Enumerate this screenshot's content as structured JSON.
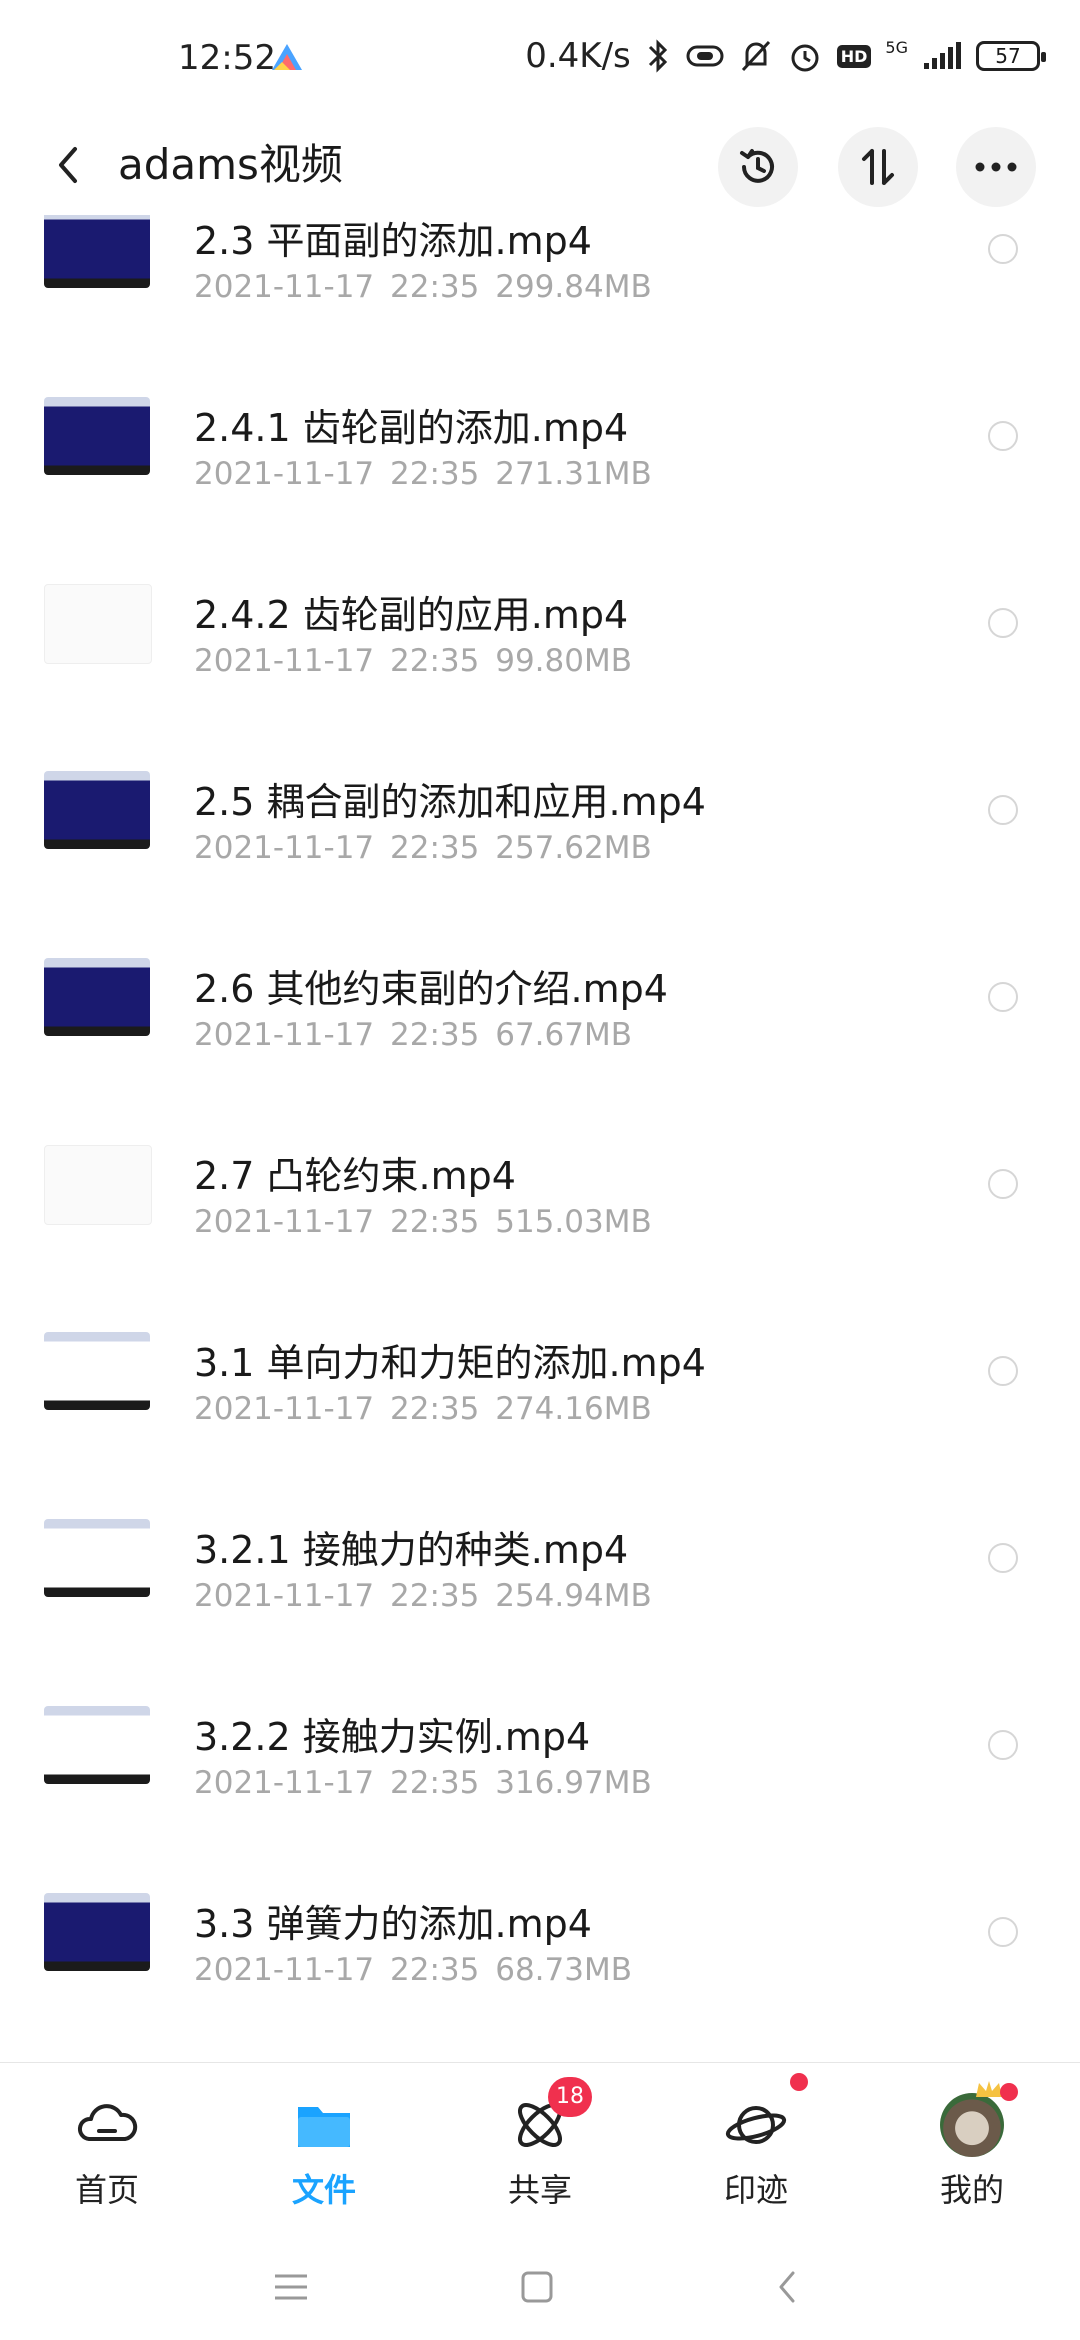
{
  "status_bar": {
    "time": "12:52",
    "network_speed": "0.4K/s",
    "network_type": "5G",
    "battery": "57",
    "hd": "HD",
    "icons": [
      "bluetooth-icon",
      "link-icon",
      "mute-bell-icon",
      "alarm-icon",
      "hd-icon",
      "signal-icon",
      "battery-icon"
    ]
  },
  "header": {
    "title": "adams视频",
    "back_icon": "chevron-left-icon",
    "actions": [
      "history-icon",
      "sort-icon",
      "more-icon"
    ]
  },
  "files": [
    {
      "name": "2.3 平面副的添加.mp4",
      "date": "2021-11-17",
      "time": "22:35",
      "size": "299.84MB",
      "thumb": "blue"
    },
    {
      "name": "2.4.1 齿轮副的添加.mp4",
      "date": "2021-11-17",
      "time": "22:35",
      "size": "271.31MB",
      "thumb": "blue"
    },
    {
      "name": "2.4.2 齿轮副的应用.mp4",
      "date": "2021-11-17",
      "time": "22:35",
      "size": "99.80MB",
      "thumb": "white"
    },
    {
      "name": "2.5 耦合副的添加和应用.mp4",
      "date": "2021-11-17",
      "time": "22:35",
      "size": "257.62MB",
      "thumb": "blue"
    },
    {
      "name": "2.6 其他约束副的介绍.mp4",
      "date": "2021-11-17",
      "time": "22:35",
      "size": "67.67MB",
      "thumb": "blue"
    },
    {
      "name": "2.7 凸轮约束.mp4",
      "date": "2021-11-17",
      "time": "22:35",
      "size": "515.03MB",
      "thumb": "white"
    },
    {
      "name": "3.1 单向力和力矩的添加.mp4",
      "date": "2021-11-17",
      "time": "22:35",
      "size": "274.16MB",
      "thumb": "cyan"
    },
    {
      "name": "3.2.1 接触力的种类.mp4",
      "date": "2021-11-17",
      "time": "22:35",
      "size": "254.94MB",
      "thumb": "cyan"
    },
    {
      "name": "3.2.2 接触力实例.mp4",
      "date": "2021-11-17",
      "time": "22:35",
      "size": "316.97MB",
      "thumb": "cyan"
    },
    {
      "name": "3.3 弹簧力的添加.mp4",
      "date": "2021-11-17",
      "time": "22:35",
      "size": "68.73MB",
      "thumb": "blue"
    }
  ],
  "bottom_nav": {
    "items": [
      {
        "label": "首页",
        "icon": "cloud-home-icon"
      },
      {
        "label": "文件",
        "icon": "folder-icon",
        "active": true
      },
      {
        "label": "共享",
        "icon": "share-atom-icon",
        "badge": "18"
      },
      {
        "label": "印迹",
        "icon": "planet-icon",
        "dot": true
      },
      {
        "label": "我的",
        "icon": "avatar",
        "dot": true
      }
    ],
    "active_color": "#1aa3ff",
    "badge_color": "#f0304e"
  },
  "system_nav": [
    "menu-icon",
    "home-icon",
    "back-icon"
  ]
}
